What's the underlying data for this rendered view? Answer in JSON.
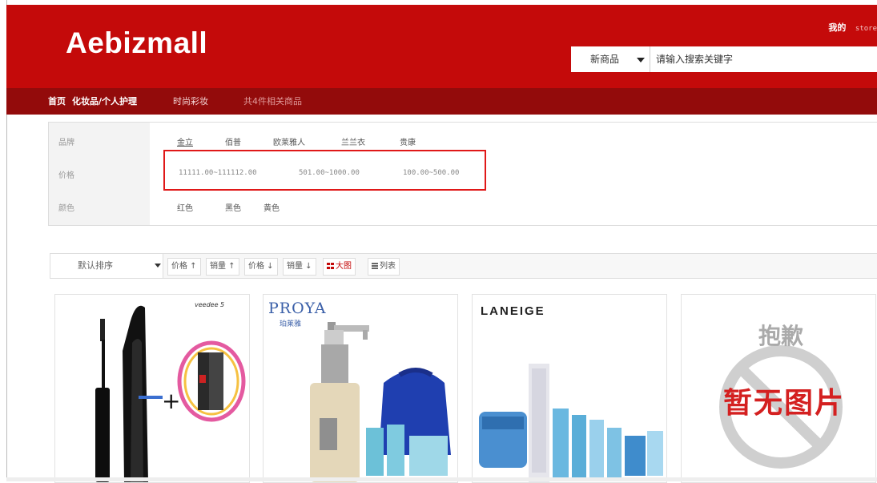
{
  "header": {
    "logo": "Aebizmall",
    "user_link": "我的",
    "store_link": "store"
  },
  "search": {
    "category": "新商品",
    "placeholder": "请输入搜索关键字"
  },
  "nav": {
    "home": "首页",
    "category": "化妆品/个人护理",
    "fashion": "时尚彩妆",
    "count_text": "共4件相关商品"
  },
  "filters": {
    "brand": {
      "label": "品牌",
      "values": [
        "金立",
        "佰普",
        "欧莱雅人",
        "兰兰衣",
        "贵康"
      ]
    },
    "price": {
      "label": "价格",
      "values": [
        "11111.00~111112.00",
        "501.00~1000.00",
        "100.00~500.00"
      ]
    },
    "color": {
      "label": "颜色",
      "values": [
        "红色",
        "黑色",
        "黄色"
      ]
    }
  },
  "toolbar": {
    "sort_default": "默认排序",
    "sort_buttons": [
      "价格 ↑",
      "销量 ↑",
      "价格 ↓",
      "销量 ↓"
    ],
    "view_grid": "大图",
    "view_list": "列表"
  },
  "products": [
    {
      "brand": "veedee 5"
    },
    {
      "brand": "PROYA",
      "brand_sub": "珀莱雅"
    },
    {
      "brand": "LANEIGE"
    },
    {
      "no_image_top": "抱歉",
      "no_image_main": "暂无图片"
    }
  ],
  "colors": {
    "header_red": "#c40a0a",
    "nav_red": "#930b0b",
    "highlight": "#e01818"
  }
}
